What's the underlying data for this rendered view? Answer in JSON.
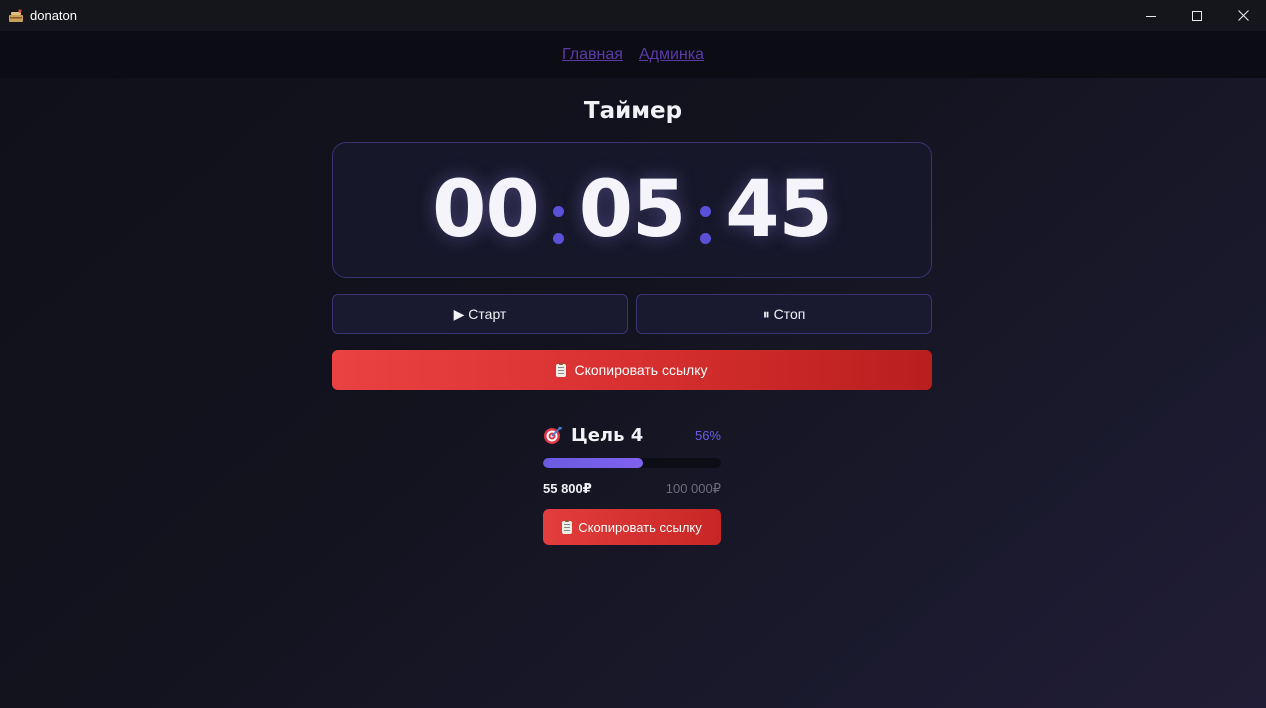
{
  "window": {
    "title": "donaton",
    "minimize_label": "—",
    "maximize_label": "☐",
    "close_label": "✕"
  },
  "nav": {
    "links": [
      {
        "label": "Главная"
      },
      {
        "label": "Админка"
      }
    ]
  },
  "timer": {
    "title": "Таймер",
    "hours": "00",
    "minutes": "05",
    "seconds": "45",
    "start_label": "▶ Старт",
    "stop_label": "⏸ Стоп",
    "copy_label": "Скопировать ссылку"
  },
  "goal": {
    "title": "Цель 4",
    "percent_label": "56%",
    "progress": 0.56,
    "current": "55 800₽",
    "target": "100 000₽",
    "copy_label": "Скопировать ссылку"
  },
  "colors": {
    "accent": "#5b51d8",
    "danger": "#e43d3d",
    "link": "#5b3aa8"
  }
}
